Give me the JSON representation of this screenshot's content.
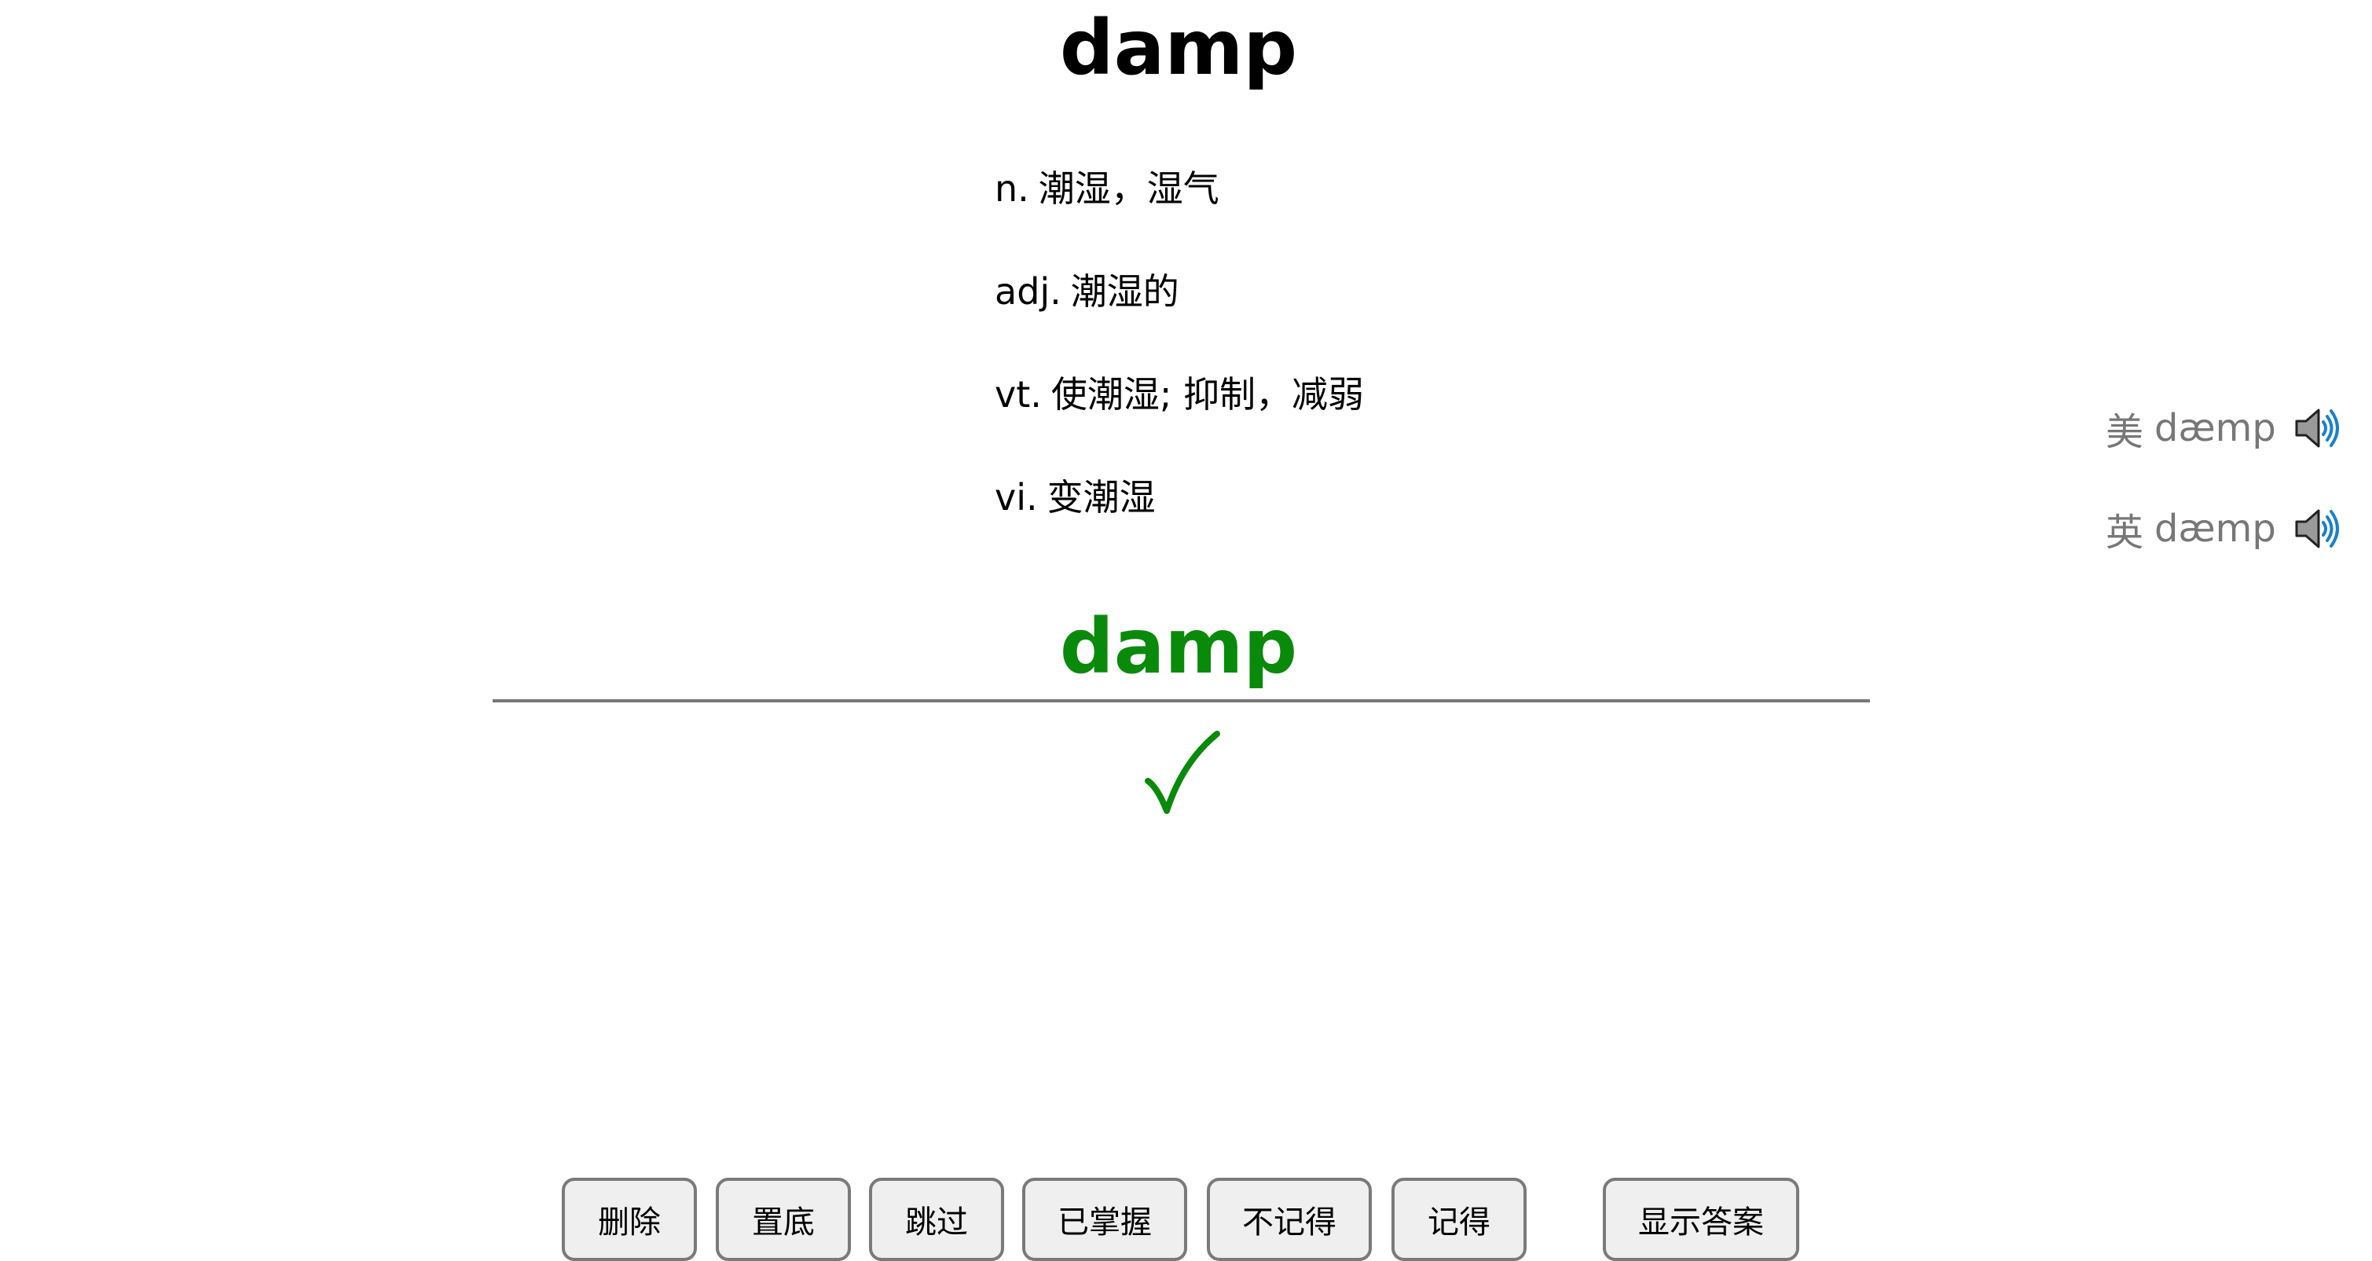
{
  "word": "damp",
  "definitions": [
    {
      "pos": "n.",
      "meaning": "潮湿，湿气"
    },
    {
      "pos": "adj.",
      "meaning": "潮湿的"
    },
    {
      "pos": "vt.",
      "meaning": "使潮湿; 抑制，减弱"
    },
    {
      "pos": "vi.",
      "meaning": "变潮湿"
    }
  ],
  "phonetics": [
    {
      "region": "美",
      "ipa": "dæmp",
      "icon": "speaker-icon"
    },
    {
      "region": "英",
      "ipa": "dæmp",
      "icon": "speaker-icon"
    }
  ],
  "answer": {
    "typed": "damp",
    "result_mark": "✓",
    "correct_color": "#0a8a0a"
  },
  "buttons": {
    "delete": "删除",
    "bottom": "置底",
    "skip": "跳过",
    "mastered": "已掌握",
    "forgot": "不记得",
    "remember": "记得",
    "show_answer": "显示答案"
  }
}
